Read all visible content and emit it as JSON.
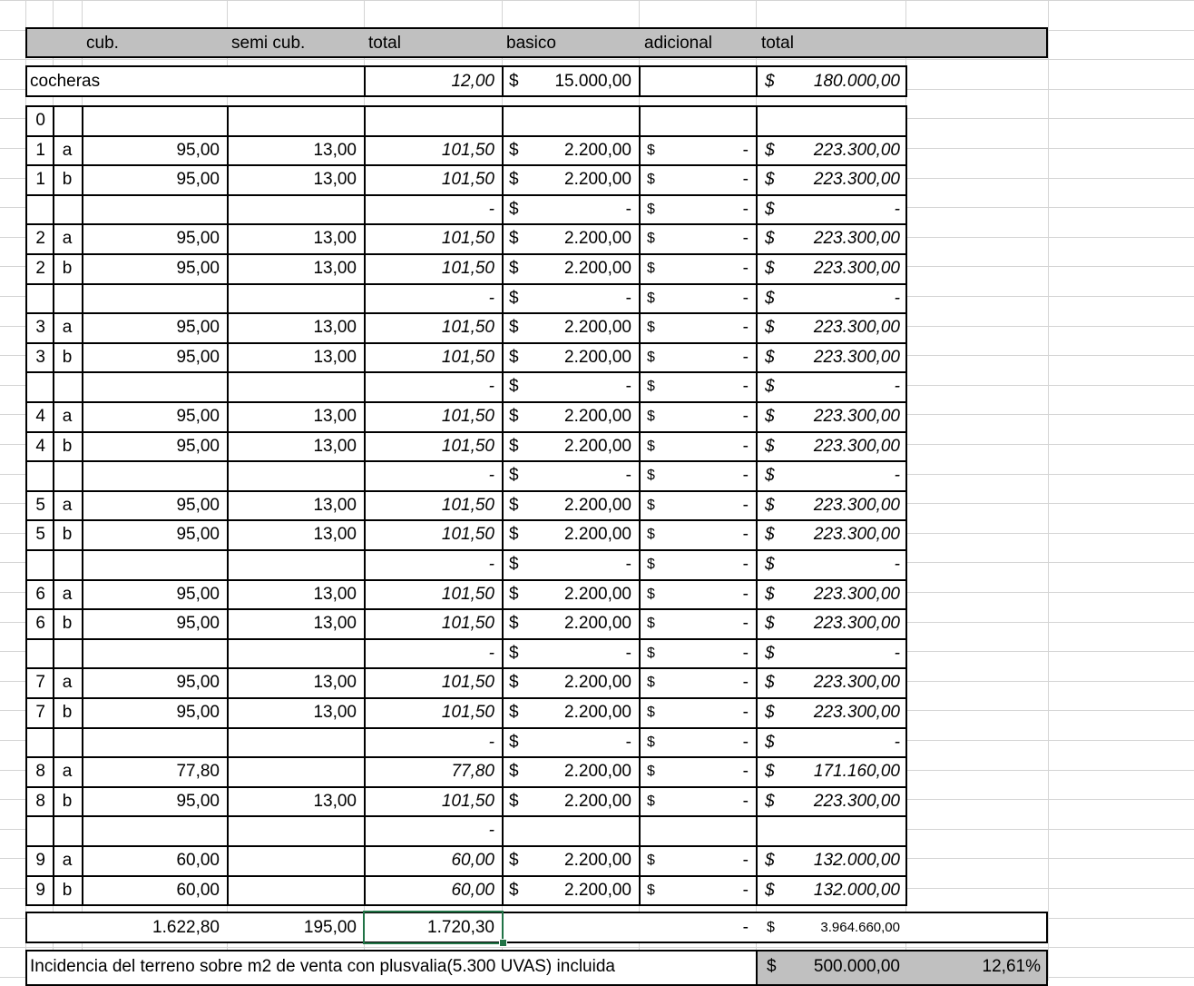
{
  "header": {
    "cub": "cub.",
    "semi_cub": "semi cub.",
    "total": "total",
    "basico": "basico",
    "adicional": "adicional",
    "total2": "total"
  },
  "cocheras": {
    "label": "cocheras",
    "total": "12,00",
    "basico_currency": "$",
    "basico": "15.000,00",
    "total_currency": "$",
    "total_value": "180.000,00"
  },
  "rows": [
    {
      "piso": "0",
      "dpto": "",
      "cub": "",
      "semi": "",
      "total": "",
      "basico": "",
      "basico_cur": "",
      "adic": "",
      "adic_cur": "",
      "tot": "",
      "tot_cur": ""
    },
    {
      "piso": "1",
      "dpto": "a",
      "cub": "95,00",
      "semi": "13,00",
      "total": "101,50",
      "basico_cur": "$",
      "basico": "2.200,00",
      "adic_cur": "$",
      "adic": "-",
      "tot_cur": "$",
      "tot": "223.300,00"
    },
    {
      "piso": "1",
      "dpto": "b",
      "cub": "95,00",
      "semi": "13,00",
      "total": "101,50",
      "basico_cur": "$",
      "basico": "2.200,00",
      "adic_cur": "$",
      "adic": "-",
      "tot_cur": "$",
      "tot": "223.300,00"
    },
    {
      "piso": "",
      "dpto": "",
      "cub": "",
      "semi": "",
      "total": "-",
      "basico_cur": "$",
      "basico": "-",
      "adic_cur": "$",
      "adic": "-",
      "tot_cur": "$",
      "tot": "-"
    },
    {
      "piso": "2",
      "dpto": "a",
      "cub": "95,00",
      "semi": "13,00",
      "total": "101,50",
      "basico_cur": "$",
      "basico": "2.200,00",
      "adic_cur": "$",
      "adic": "-",
      "tot_cur": "$",
      "tot": "223.300,00"
    },
    {
      "piso": "2",
      "dpto": "b",
      "cub": "95,00",
      "semi": "13,00",
      "total": "101,50",
      "basico_cur": "$",
      "basico": "2.200,00",
      "adic_cur": "$",
      "adic": "-",
      "tot_cur": "$",
      "tot": "223.300,00"
    },
    {
      "piso": "",
      "dpto": "",
      "cub": "",
      "semi": "",
      "total": "-",
      "basico_cur": "$",
      "basico": "-",
      "adic_cur": "$",
      "adic": "-",
      "tot_cur": "$",
      "tot": "-"
    },
    {
      "piso": "3",
      "dpto": "a",
      "cub": "95,00",
      "semi": "13,00",
      "total": "101,50",
      "basico_cur": "$",
      "basico": "2.200,00",
      "adic_cur": "$",
      "adic": "-",
      "tot_cur": "$",
      "tot": "223.300,00"
    },
    {
      "piso": "3",
      "dpto": "b",
      "cub": "95,00",
      "semi": "13,00",
      "total": "101,50",
      "basico_cur": "$",
      "basico": "2.200,00",
      "adic_cur": "$",
      "adic": "-",
      "tot_cur": "$",
      "tot": "223.300,00"
    },
    {
      "piso": "",
      "dpto": "",
      "cub": "",
      "semi": "",
      "total": "-",
      "basico_cur": "$",
      "basico": "-",
      "adic_cur": "$",
      "adic": "-",
      "tot_cur": "$",
      "tot": "-"
    },
    {
      "piso": "4",
      "dpto": "a",
      "cub": "95,00",
      "semi": "13,00",
      "total": "101,50",
      "basico_cur": "$",
      "basico": "2.200,00",
      "adic_cur": "$",
      "adic": "-",
      "tot_cur": "$",
      "tot": "223.300,00"
    },
    {
      "piso": "4",
      "dpto": "b",
      "cub": "95,00",
      "semi": "13,00",
      "total": "101,50",
      "basico_cur": "$",
      "basico": "2.200,00",
      "adic_cur": "$",
      "adic": "-",
      "tot_cur": "$",
      "tot": "223.300,00"
    },
    {
      "piso": "",
      "dpto": "",
      "cub": "",
      "semi": "",
      "total": "-",
      "basico_cur": "$",
      "basico": "-",
      "adic_cur": "$",
      "adic": "-",
      "tot_cur": "$",
      "tot": "-"
    },
    {
      "piso": "5",
      "dpto": "a",
      "cub": "95,00",
      "semi": "13,00",
      "total": "101,50",
      "basico_cur": "$",
      "basico": "2.200,00",
      "adic_cur": "$",
      "adic": "-",
      "tot_cur": "$",
      "tot": "223.300,00"
    },
    {
      "piso": "5",
      "dpto": "b",
      "cub": "95,00",
      "semi": "13,00",
      "total": "101,50",
      "basico_cur": "$",
      "basico": "2.200,00",
      "adic_cur": "$",
      "adic": "-",
      "tot_cur": "$",
      "tot": "223.300,00"
    },
    {
      "piso": "",
      "dpto": "",
      "cub": "",
      "semi": "",
      "total": "-",
      "basico_cur": "$",
      "basico": "-",
      "adic_cur": "$",
      "adic": "-",
      "tot_cur": "$",
      "tot": "-"
    },
    {
      "piso": "6",
      "dpto": "a",
      "cub": "95,00",
      "semi": "13,00",
      "total": "101,50",
      "basico_cur": "$",
      "basico": "2.200,00",
      "adic_cur": "$",
      "adic": "-",
      "tot_cur": "$",
      "tot": "223.300,00"
    },
    {
      "piso": "6",
      "dpto": "b",
      "cub": "95,00",
      "semi": "13,00",
      "total": "101,50",
      "basico_cur": "$",
      "basico": "2.200,00",
      "adic_cur": "$",
      "adic": "-",
      "tot_cur": "$",
      "tot": "223.300,00"
    },
    {
      "piso": "",
      "dpto": "",
      "cub": "",
      "semi": "",
      "total": "-",
      "basico_cur": "$",
      "basico": "-",
      "adic_cur": "$",
      "adic": "-",
      "tot_cur": "$",
      "tot": "-"
    },
    {
      "piso": "7",
      "dpto": "a",
      "cub": "95,00",
      "semi": "13,00",
      "total": "101,50",
      "basico_cur": "$",
      "basico": "2.200,00",
      "adic_cur": "$",
      "adic": "-",
      "tot_cur": "$",
      "tot": "223.300,00"
    },
    {
      "piso": "7",
      "dpto": "b",
      "cub": "95,00",
      "semi": "13,00",
      "total": "101,50",
      "basico_cur": "$",
      "basico": "2.200,00",
      "adic_cur": "$",
      "adic": "-",
      "tot_cur": "$",
      "tot": "223.300,00"
    },
    {
      "piso": "",
      "dpto": "",
      "cub": "",
      "semi": "",
      "total": "-",
      "basico_cur": "$",
      "basico": "-",
      "adic_cur": "$",
      "adic": "-",
      "tot_cur": "$",
      "tot": "-"
    },
    {
      "piso": "8",
      "dpto": "a",
      "cub": "77,80",
      "semi": "",
      "total": "77,80",
      "basico_cur": "$",
      "basico": "2.200,00",
      "adic_cur": "$",
      "adic": "-",
      "tot_cur": "$",
      "tot": "171.160,00"
    },
    {
      "piso": "8",
      "dpto": "b",
      "cub": "95,00",
      "semi": "13,00",
      "total": "101,50",
      "basico_cur": "$",
      "basico": "2.200,00",
      "adic_cur": "$",
      "adic": "-",
      "tot_cur": "$",
      "tot": "223.300,00"
    },
    {
      "piso": "",
      "dpto": "",
      "cub": "",
      "semi": "",
      "total": "-",
      "basico_cur": "",
      "basico": "",
      "adic_cur": "",
      "adic": "",
      "tot_cur": "",
      "tot": ""
    },
    {
      "piso": "9",
      "dpto": "a",
      "cub": "60,00",
      "semi": "",
      "total": "60,00",
      "basico_cur": "$",
      "basico": "2.200,00",
      "adic_cur": "$",
      "adic": "-",
      "tot_cur": "$",
      "tot": "132.000,00"
    },
    {
      "piso": "9",
      "dpto": "b",
      "cub": "60,00",
      "semi": "",
      "total": "60,00",
      "basico_cur": "$",
      "basico": "2.200,00",
      "adic_cur": "$",
      "adic": "-",
      "tot_cur": "$",
      "tot": "132.000,00"
    }
  ],
  "totals": {
    "cub": "1.622,80",
    "semi": "195,00",
    "total": "1.720,30",
    "adic": "-",
    "tot_cur": "$",
    "tot": "3.964.660,00"
  },
  "footer": {
    "label": "Incidencia del terreno sobre m2 de venta con plusvalia(5.300 UVAS)  incluida",
    "currency": "$",
    "value": "500.000,00",
    "percent": "12,61%"
  },
  "colors": {
    "header_bg": "#c0c0c0",
    "grid": "#d4d4d4",
    "selection": "#217346"
  }
}
